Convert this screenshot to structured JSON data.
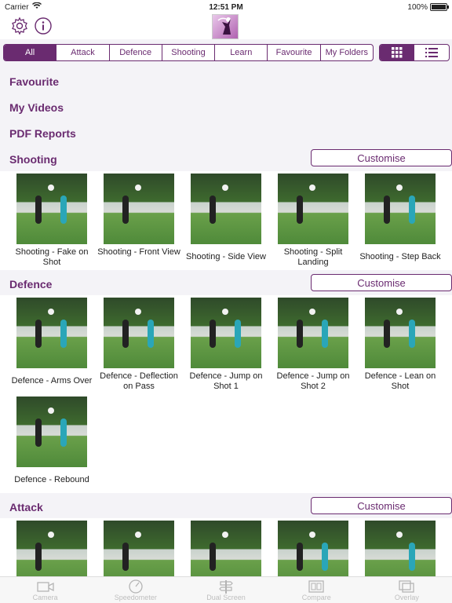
{
  "status": {
    "carrier": "Carrier",
    "time": "12:51 PM",
    "battery": "100%"
  },
  "filters": [
    "All",
    "Attack",
    "Defence",
    "Shooting",
    "Learn",
    "Favourite",
    "My Folders"
  ],
  "links": [
    "Favourite",
    "My Videos",
    "PDF Reports"
  ],
  "customise_label": "Customise",
  "sections": {
    "shooting": {
      "title": "Shooting",
      "items": [
        "Shooting - Fake on Shot",
        "Shooting - Front View",
        "Shooting - Side View",
        "Shooting - Split Landing",
        "Shooting - Step Back"
      ]
    },
    "defence": {
      "title": "Defence",
      "items": [
        "Defence - Arms Over",
        "Defence - Deflection on Pass",
        "Defence - Jump on Shot 1",
        "Defence - Jump on Shot 2",
        "Defence - Lean on Shot",
        "Defence - Rebound"
      ]
    },
    "attack": {
      "title": "Attack"
    }
  },
  "bottom_tabs": [
    "Camera",
    "Speedometer",
    "Dual Screen",
    "Compare",
    "Overlay"
  ],
  "colors": {
    "accent": "#6a2b70"
  }
}
